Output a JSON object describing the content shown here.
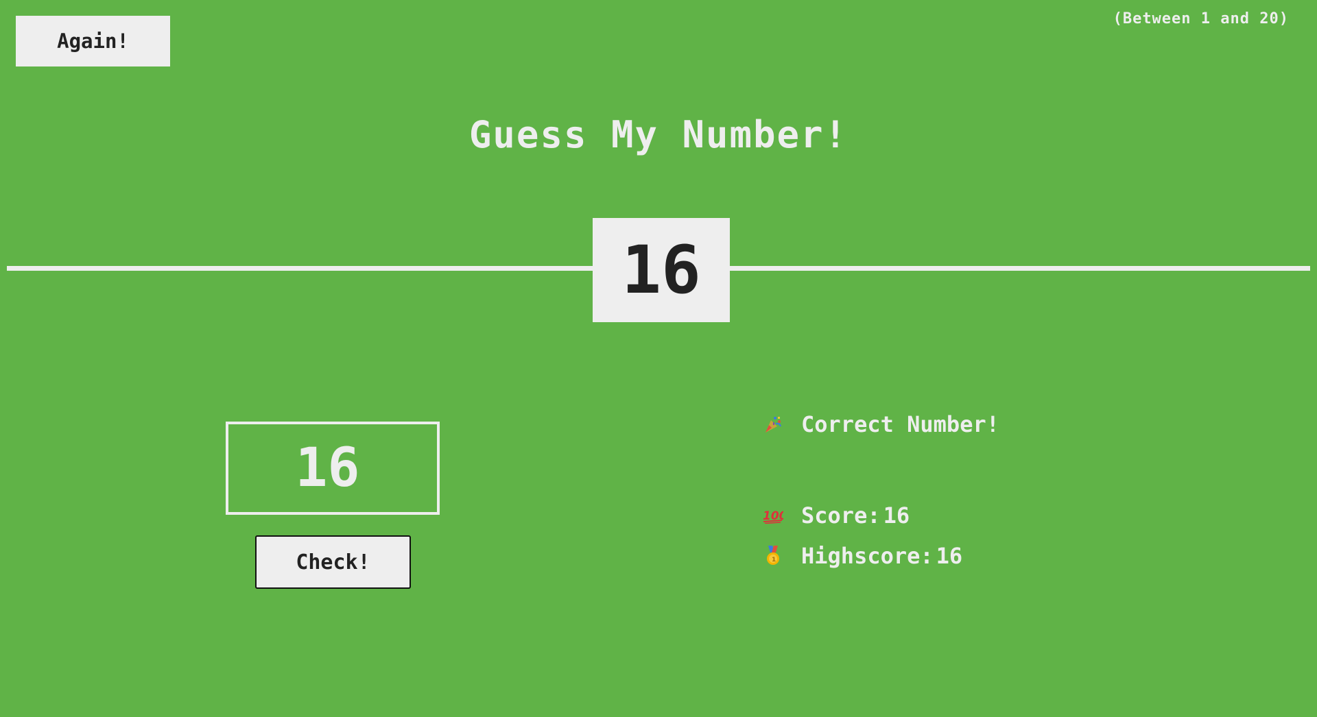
{
  "header": {
    "again_label": "Again!",
    "range_hint": "(Between 1 and 20)"
  },
  "title": "Guess My Number!",
  "secret_number": "16",
  "guess": {
    "value": "16"
  },
  "check_label": "Check!",
  "message": {
    "icon": "party-popper-icon",
    "text": "Correct Number!"
  },
  "score": {
    "icon": "hundred-points-icon",
    "label": "Score:",
    "value": "16"
  },
  "highscore": {
    "icon": "medal-icon",
    "label": "Highscore:",
    "value": "16"
  },
  "colors": {
    "background": "#60b347",
    "light": "#eeeeee",
    "dark": "#222222"
  }
}
